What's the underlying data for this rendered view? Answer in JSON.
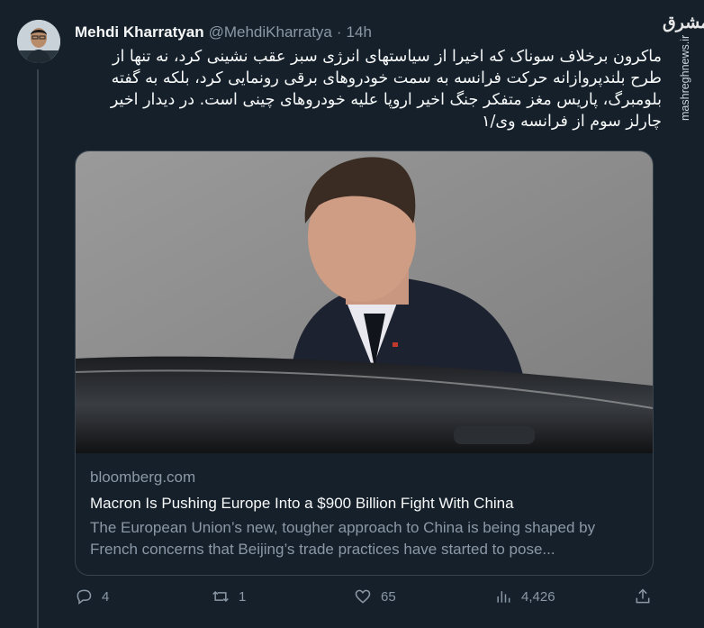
{
  "author": {
    "name": "Mehdi Kharratyan",
    "handle": "@MehdiKharratya",
    "separator": "·",
    "time": "14h"
  },
  "tweet": {
    "text": "ماکرون برخلاف سوناک که اخیرا از سیاستهای انرژی سبز عقب نشینی کرد، نه تنها از طرح بلندپروازانه حرکت فرانسه به سمت خودروهای برقی رونمایی کرد، بلکه به گفته بلومبرگ، پاریس مغز متفکر جنگ اخیر اروپا علیه خودروهای چینی است. در دیدار اخیر چارلز سوم از فرانسه وی/۱"
  },
  "card": {
    "domain": "bloomberg.com",
    "title": "Macron Is Pushing Europe Into a $900 Billion Fight With China",
    "description": "The European Union’s new, tougher approach to China is being shaped by French concerns that Beijing’s trade practices have started to pose..."
  },
  "actions": {
    "replies": "4",
    "retweets": "1",
    "likes": "65",
    "views": "4,426"
  },
  "watermark": {
    "logo": "مشرق",
    "site": "mashreghnews.ir"
  },
  "icons": {
    "reply": "reply-icon",
    "retweet": "retweet-icon",
    "like": "heart-icon",
    "views": "views-icon",
    "share": "share-icon"
  }
}
